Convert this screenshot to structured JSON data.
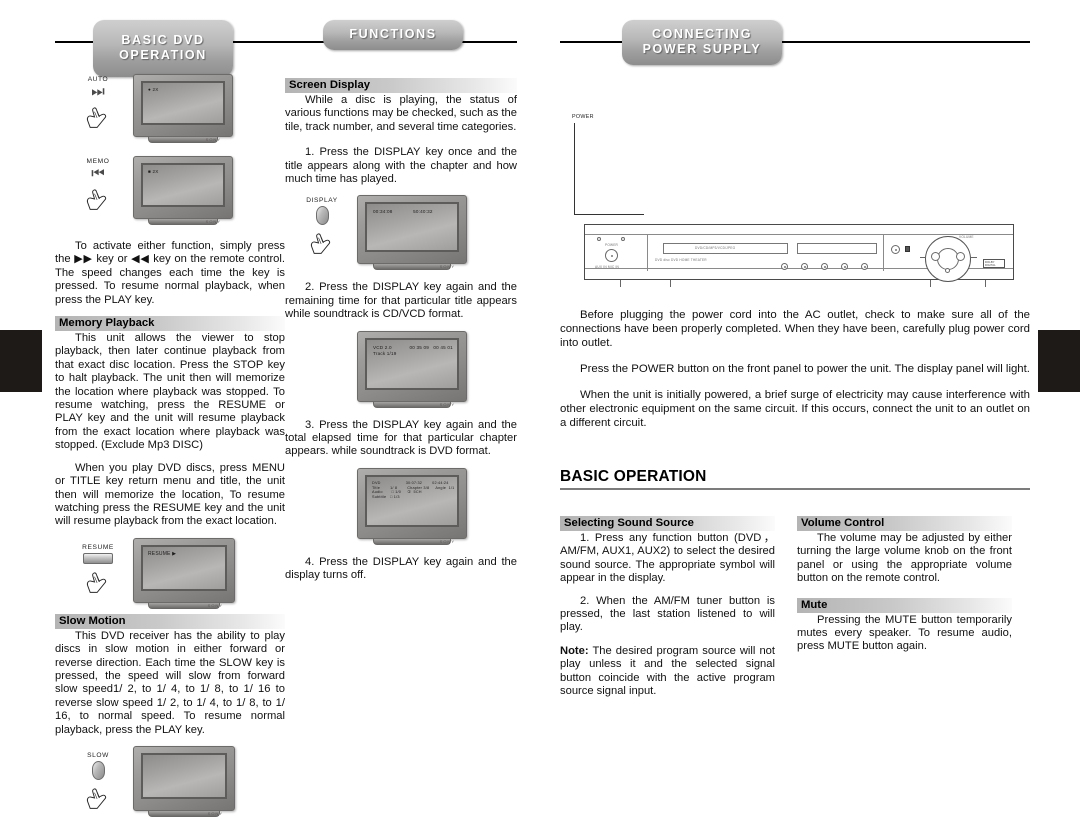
{
  "document": {
    "type": "dvd-receiver-user-manual-page"
  },
  "banners": {
    "basic_dvd_operation": "BASIC DVD\nOPERATION",
    "functions": "FUNCTIONS",
    "connecting_power_supply": "CONNECTING\nPOWER SUPPLY"
  },
  "column_one": {
    "controls": [
      {
        "label": "AUTO",
        "glyph": "fast-forward"
      },
      {
        "label": "MEMO",
        "glyph": "rewind"
      },
      {
        "label": "RESUME",
        "glyph": "rect-key"
      },
      {
        "label": "SLOW",
        "glyph": "oval-key"
      }
    ],
    "tv_osd": {
      "auto": "● 2X",
      "memo": "■ 2X",
      "resume": "RESUME ▶"
    },
    "intro_paragraph": "To activate either function, simply press the ▶▶ key or ◀◀ key on the remote control. The speed changes each time the key is pressed. To resume normal playback, when press the PLAY key.",
    "memory_playback": {
      "heading": "Memory Playback",
      "paragraph_1": "This unit allows the viewer to stop playback, then later continue playback from that exact disc location. Press the STOP key to halt playback. The unit then will memorize the location where playback was stopped. To resume watching, press the RESUME or PLAY key and the unit will resume playback from the exact location where playback was stopped. (Exclude Mp3 DISC)",
      "paragraph_2": "When you play DVD discs, press MENU or TITLE key return menu and title, the unit then will memorize the location, To resume watching press the RESUME key and the unit will resume playback from the exact location."
    },
    "slow_motion": {
      "heading": "Slow Motion",
      "paragraph_1": "This DVD receiver has the ability to play discs in slow motion in either forward or reverse direction. Each time the SLOW key is pressed, the speed will slow from forward slow speed1/ 2, to 1/ 4, to 1/ 8, to 1/ 16 to reverse slow speed 1/ 2, to 1/ 4, to 1/ 8, to 1/ 16, to normal speed. To resume normal playback, press the PLAY key."
    }
  },
  "column_two": {
    "screen_display": {
      "heading": "Screen Display",
      "paragraph_1": "While a disc is playing, the status of various functions may be checked, such as the tile, track number, and several time categories.",
      "step_1": "1. Press the DISPLAY key once and the title appears along with the chapter and how much time has played.",
      "step_2": "2. Press the DISPLAY key again and the remaining time for that particular title appears while soundtrack is CD/VCD format.",
      "step_3": "3. Press the DISPLAY key again and the total elapsed time for that particular chapter appears. while soundtrack is DVD format.",
      "step_4": "4. Press the DISPLAY key again and the display turns off."
    },
    "control": {
      "label": "DISPLAY",
      "glyph": "oval-key"
    },
    "tv_osd": {
      "title_time": "00:34:08              50:40:32",
      "vcd_track": "VCD 2.0            00 35 09   00 45 01\nTrack 1/19",
      "dvd_info": "DVD                    30:07:32        02:44:24\nTitle        1/ 8        Chapter 3/8     Angle  1/1\nAudio       □ 1/0     ①  5CH\nSubtitle   □ 1/3"
    }
  },
  "column_three": {
    "diagram": {
      "lead_label": "POWER",
      "panel_labels": {
        "power": "POWER",
        "inputs": "AUX IN    MIC IN",
        "display_text": "DVD/CD/MP3/VCD/JPEG",
        "model_text": "DVD disc DVD HOME THEATER",
        "volume": "VOLUME",
        "logo": "DOLBY DIGITAL"
      }
    },
    "paragraphs": [
      "Before plugging the power cord into the AC outlet, check to make sure all of the connections have been properly completed. When they have been, carefully plug power cord into outlet.",
      "Press the POWER button on the front panel to power the unit. The display panel will light.",
      "When the unit is initially powered, a brief surge of electricity may cause interference with other electronic equipment on the same circuit. If this occurs, connect the unit to an outlet on a different circuit."
    ],
    "basic_operation": {
      "heading": "BASIC OPERATION",
      "selecting_sound_source": {
        "heading": "Selecting Sound Source",
        "step_1": "1. Press any function button (DVD，AM/FM, AUX1, AUX2) to select the desired sound source. The appropriate symbol will appear in the display.",
        "step_2": "2. When the AM/FM tuner button is pressed, the last station listened to will play.",
        "note_label": "Note:",
        "note_text": " The desired program source will not play unless it and the selected signal button coincide with the active program source signal input."
      },
      "volume_control": {
        "heading": "Volume Control",
        "paragraph": "The volume may be adjusted by either turning the large volume knob on the front panel or using the appropriate volume button on the remote control."
      },
      "mute": {
        "heading": "Mute",
        "paragraph": "Pressing the MUTE button temporarily mutes every speaker. To resume audio, press MUTE button again."
      }
    }
  }
}
